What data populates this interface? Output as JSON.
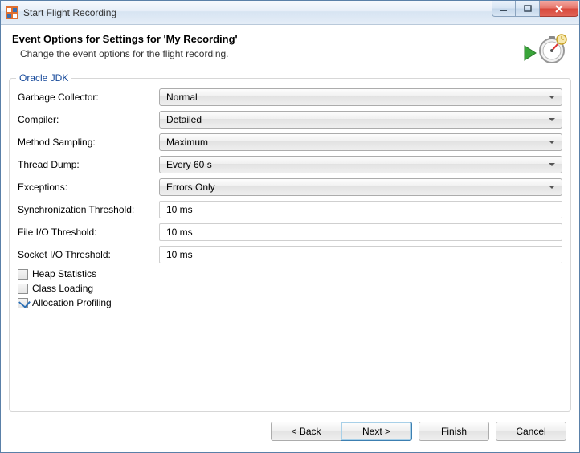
{
  "window": {
    "title": "Start Flight Recording"
  },
  "banner": {
    "heading": "Event Options for Settings for 'My Recording'",
    "subtitle": "Change the event options for the flight recording."
  },
  "group": {
    "legend": "Oracle JDK",
    "fields": {
      "garbage_collector": {
        "label": "Garbage Collector:",
        "value": "Normal"
      },
      "compiler": {
        "label": "Compiler:",
        "value": "Detailed"
      },
      "method_sampling": {
        "label": "Method Sampling:",
        "value": "Maximum"
      },
      "thread_dump": {
        "label": "Thread Dump:",
        "value": "Every 60 s"
      },
      "exceptions": {
        "label": "Exceptions:",
        "value": "Errors Only"
      },
      "sync_threshold": {
        "label": "Synchronization Threshold:",
        "value": "10 ms"
      },
      "file_io_threshold": {
        "label": "File I/O Threshold:",
        "value": "10 ms"
      },
      "socket_io_threshold": {
        "label": "Socket I/O Threshold:",
        "value": "10 ms"
      }
    },
    "checks": {
      "heap_statistics": {
        "label": "Heap Statistics",
        "checked": false
      },
      "class_loading": {
        "label": "Class Loading",
        "checked": false
      },
      "allocation_profiling": {
        "label": "Allocation Profiling",
        "checked": true
      }
    }
  },
  "buttons": {
    "back": "< Back",
    "next": "Next >",
    "finish": "Finish",
    "cancel": "Cancel"
  }
}
